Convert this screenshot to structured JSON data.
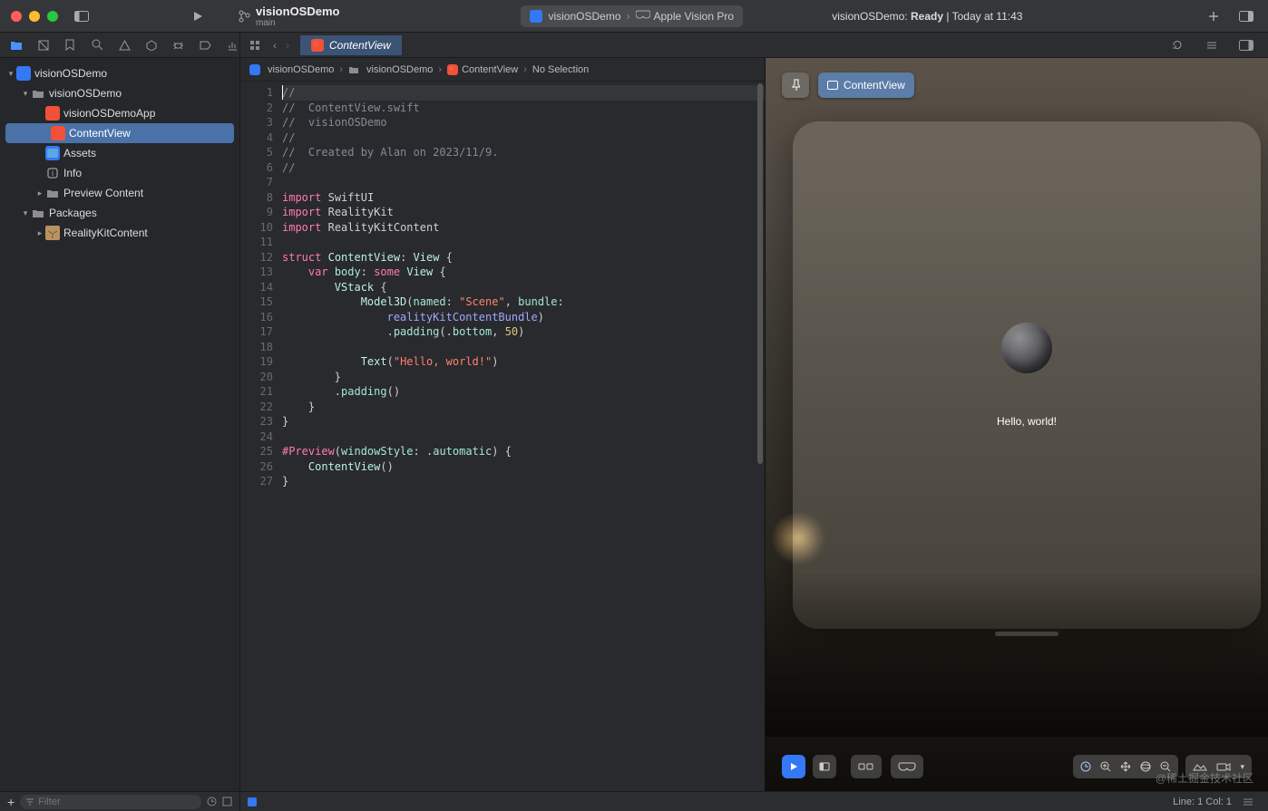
{
  "toolbar": {
    "project_name": "visionOSDemo",
    "branch": "main",
    "scheme": "visionOSDemo",
    "destination": "Apple Vision Pro",
    "status_prefix": "visionOSDemo:",
    "status_state": "Ready",
    "status_sep": "|",
    "status_time": "Today at 11:43"
  },
  "tab": {
    "title": "ContentView"
  },
  "breadcrumb": {
    "items": [
      "visionOSDemo",
      "visionOSDemo",
      "ContentView",
      "No Selection"
    ]
  },
  "tree": {
    "root": "visionOSDemo",
    "group": "visionOSDemo",
    "app_file": "visionOSDemoApp",
    "content_view": "ContentView",
    "assets": "Assets",
    "info": "Info",
    "preview_content": "Preview Content",
    "packages": "Packages",
    "reality_pkg": "RealityKitContent"
  },
  "code": {
    "lines": [
      {
        "n": 1,
        "html": "<span class='c'>//</span>"
      },
      {
        "n": 2,
        "html": "<span class='c'>//  ContentView.swift</span>"
      },
      {
        "n": 3,
        "html": "<span class='c'>//  visionOSDemo</span>"
      },
      {
        "n": 4,
        "html": "<span class='c'>//</span>"
      },
      {
        "n": 5,
        "html": "<span class='c'>//  Created by Alan on 2023/11/9.</span>"
      },
      {
        "n": 6,
        "html": "<span class='c'>//</span>"
      },
      {
        "n": 7,
        "html": ""
      },
      {
        "n": 8,
        "html": "<span class='k'>import</span> <span class='p'>SwiftUI</span>"
      },
      {
        "n": 9,
        "html": "<span class='k'>import</span> <span class='p'>RealityKit</span>"
      },
      {
        "n": 10,
        "html": "<span class='k'>import</span> <span class='p'>RealityKitContent</span>"
      },
      {
        "n": 11,
        "html": ""
      },
      {
        "n": 12,
        "html": "<span class='k'>struct</span> <span class='t'>ContentView</span><span class='p'>:</span> <span class='t'>View</span> <span class='p'>{</span>"
      },
      {
        "n": 13,
        "html": "    <span class='k'>var</span> <span class='self'>body</span><span class='p'>:</span> <span class='k'>some</span> <span class='t'>View</span> <span class='p'>{</span>"
      },
      {
        "n": 14,
        "html": "        <span class='t'>VStack</span> <span class='p'>{</span>"
      },
      {
        "n": 15,
        "html": "            <span class='t'>Model3D</span><span class='p'>(</span><span class='fn'>named</span><span class='p'>:</span> <span class='s'>\"Scene\"</span><span class='p'>,</span> <span class='fn'>bundle</span><span class='p'>:</span>"
      },
      {
        "n": null,
        "html": "                <span class='id'>realityKitContentBundle</span><span class='p'>)</span>"
      },
      {
        "n": 16,
        "html": "                <span class='p'>.</span><span class='fn'>padding</span><span class='p'>(.</span><span class='fn'>bottom</span><span class='p'>,</span> <span class='n'>50</span><span class='p'>)</span>"
      },
      {
        "n": 17,
        "html": ""
      },
      {
        "n": 18,
        "html": "            <span class='t'>Text</span><span class='p'>(</span><span class='s'>\"Hello, world!\"</span><span class='p'>)</span>"
      },
      {
        "n": 19,
        "html": "        <span class='p'>}</span>"
      },
      {
        "n": 20,
        "html": "        <span class='p'>.</span><span class='fn'>padding</span><span class='p'>()</span>"
      },
      {
        "n": 21,
        "html": "    <span class='p'>}</span>"
      },
      {
        "n": 22,
        "html": "<span class='p'>}</span>"
      },
      {
        "n": 23,
        "html": ""
      },
      {
        "n": 24,
        "html": "<span class='attr'>#Preview</span><span class='p'>(</span><span class='fn'>windowStyle</span><span class='p'>:</span> <span class='p'>.</span><span class='fn'>automatic</span><span class='p'>)</span> <span class='p'>{</span>"
      },
      {
        "n": 25,
        "html": "    <span class='t'>ContentView</span><span class='p'>()</span>"
      },
      {
        "n": 26,
        "html": "<span class='p'>}</span>"
      },
      {
        "n": 27,
        "html": ""
      }
    ]
  },
  "preview": {
    "pill_label": "ContentView",
    "hello_text": "Hello, world!"
  },
  "filter": {
    "placeholder": "Filter"
  },
  "status": {
    "line_col": "Line: 1  Col: 1"
  },
  "watermark": "@稀土掘金技术社区"
}
